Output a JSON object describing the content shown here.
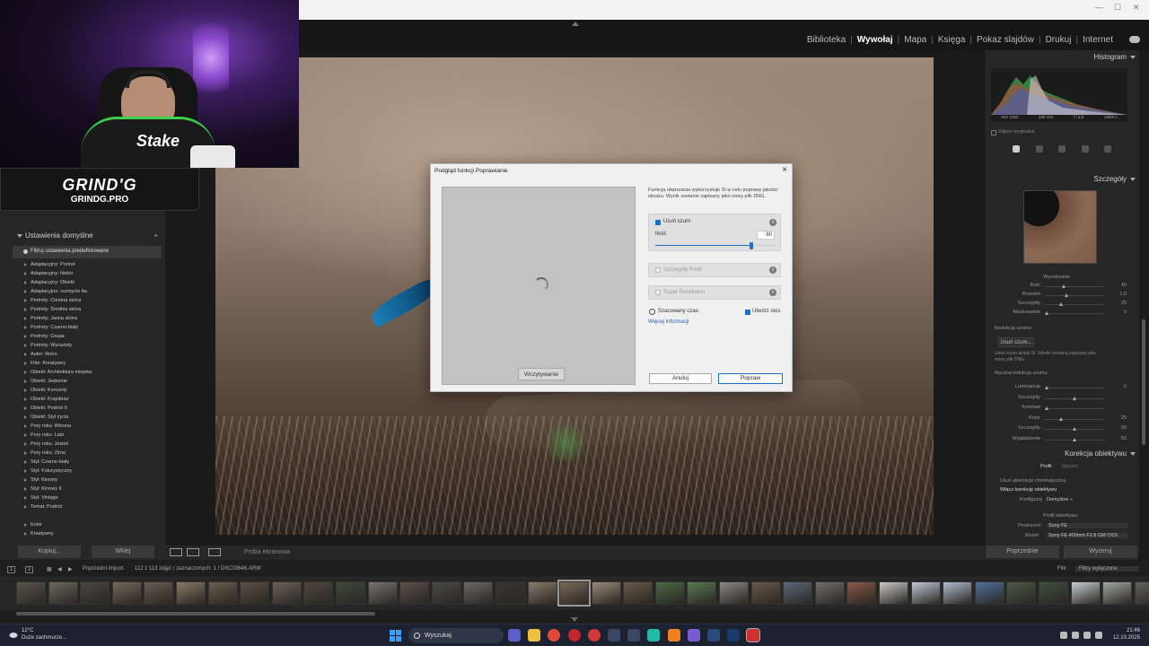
{
  "modules": [
    "Biblioteka",
    "Wywołaj",
    "Mapa",
    "Księga",
    "Pokaz slajdów",
    "Drukuj",
    "Internet"
  ],
  "active_module": "Wywołaj",
  "brand": {
    "title": "GRIND'G",
    "subtitle": "GRINDG.PRO"
  },
  "stream": {
    "shirt_text": "Stake"
  },
  "left_panel": {
    "header": "Ustawienia domyślne",
    "filter": "Filtruj ustawienia predefiniowane",
    "presets": [
      "Adaptacyjny: Portret",
      "Adaptacyjny: Niebo",
      "Adaptacyjny: Obiekt",
      "Adaptacyjne: rozmycie tła",
      "Portrety: Ciemna skóra",
      "Portrety: Średnia skóra",
      "Portrety: Jasna skóra",
      "Portrety: Czarno-biały",
      "Portrety: Grupa",
      "Portrety: Wyrazisty",
      "Autor: Retro",
      "Film: Kreatywny",
      "Obiekt: Architektura miejska",
      "Obiekt: Jedzenie",
      "Obiekt: Koncerty",
      "Obiekt: Krajobraz",
      "Obiekt: Podróż II",
      "Obiekt: Styl życia",
      "Pory roku: Wiosna",
      "Pory roku: Lato",
      "Pory roku: Jesień",
      "Pory roku: Zima",
      "Styl: Czarno-biały",
      "Styl: Futurystyczny",
      "Styl: Kinowy",
      "Styl: Kinowy II",
      "Styl: Vintage",
      "Temat: Podróż"
    ],
    "presets_extra": [
      "Kolor",
      "Kreatywny"
    ],
    "copy_button": "Kopiuj...",
    "paste_button": "Wklej"
  },
  "toolbar": {
    "proof": "Próba ekranowa"
  },
  "dialog": {
    "title": "Podgląd funkcji Poprawianie",
    "description": "Funkcja ulepszania wykorzystuje SI w celu poprawy jakości obrazu. Wynik zostanie zapisany jako nowy plik DNG.",
    "denoise_label": "Usuń szum",
    "amount_label": "Ilość",
    "amount_value": "80",
    "amount": 80,
    "raw_details_label": "Szczegóły RAW",
    "super_resolution_label": "Super Resolution",
    "estimated_time_label": "Szacowany czas:",
    "create_stack_label": "Utwórz stos",
    "more_info": "Więcej informacji",
    "loading_button": "Wczytywanie",
    "cancel_button": "Anuluj",
    "enhance_button": "Popraw",
    "close": "×",
    "info": "i"
  },
  "right_panel": {
    "histogram": "Histogram",
    "histogram_readouts": [
      "ISO 1250",
      "400 mm",
      "f / 2,8",
      "1/800 s"
    ],
    "original_photo": "Zdjęcie oryginalne",
    "details": "Szczegóły",
    "sharpening": "Wyostrzanie",
    "sharpen_rows": [
      {
        "label": "Ilość",
        "value": "40",
        "pos": 0.3
      },
      {
        "label": "Promień",
        "value": "1,0",
        "pos": 0.35
      },
      {
        "label": "Szczegóły",
        "value": "25",
        "pos": 0.25
      },
      {
        "label": "Maskowanie",
        "value": "0",
        "pos": 0.0
      }
    ],
    "noise_reduction": "Redukcja szumu",
    "denoise_button": "Usuń szum...",
    "denoise_desc": "Usuń szum dzięki SI. Wyniki zostaną zapisany jako nowy plik DNG.",
    "manual_nr": "Ręczna redukcja szumu",
    "manual_rows": [
      {
        "label": "Luminancja",
        "value": "0",
        "pos": 0.0
      },
      {
        "label": "Szczegóły",
        "value": "",
        "pos": 0.5
      },
      {
        "label": "Kontrast",
        "value": "",
        "pos": 0.0
      },
      {
        "label": "Kolor",
        "value": "25",
        "pos": 0.25
      },
      {
        "label": "Szczegóły",
        "value": "50",
        "pos": 0.5
      },
      {
        "label": "Wygładzenie",
        "value": "50",
        "pos": 0.5
      }
    ],
    "lens_correction": "Korekcja obiektywu",
    "lens_tabs": [
      "Profil",
      "Ręczny"
    ],
    "remove_ca": "Usuń aberrację chromatyczną",
    "enable_profile": "Włącz korekcję obiektywu",
    "setup_label": "Konfiguruj",
    "setup_value": "Domyślne ÷",
    "lens_profile": "Profil obiektywu",
    "maker_label": "Producent",
    "maker_value": "Sony FE",
    "model_label": "Model",
    "model_value": "Sony FE 400mm F2.8 GM OSS",
    "prev_button": "Poprzednie",
    "reset_button": "Wyzeruj"
  },
  "filmstrip": {
    "source": "Poprzedni import",
    "count": "112 z 113 zdjęć / zaznaczonych: 1 / DSC03646.ARW",
    "filter_label": "Filtr :",
    "filter_value": "Filtry wyłączone",
    "page_1": "1",
    "page_2": "2"
  },
  "taskbar": {
    "temp": "12°C",
    "weather": "Duże zachmurze...",
    "search": "Wyszukaj",
    "time": "21:46",
    "date": "12.10.2025"
  }
}
